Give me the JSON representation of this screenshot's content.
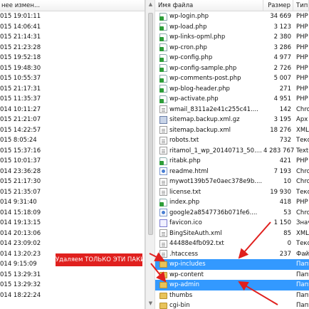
{
  "left_pane": {
    "header": "нее измен...",
    "dates": [
      "015 19:01:11",
      "015 14:06:41",
      "015 21:14:31",
      "015 21:23:28",
      "015 19:52:18",
      "015 19:48:30",
      "015 10:55:37",
      "015 21:17:31",
      "015 11:35:37",
      "014 10:11:27",
      "015 21:21:07",
      "015 14:22:57",
      "015 8:05:24",
      "015 15:37:16",
      "015 10:01:37",
      "014 23:36:28",
      "015 21:17:30",
      "015 21:35:07",
      "014 9:31:40",
      "014 15:18:09",
      "014 19:13:15",
      "014 20:13:06",
      "014 23:09:02",
      "014 13:20:23",
      "014 9:15:09",
      "015 13:29:31",
      "015 13:29:32",
      "014 18:22:24"
    ]
  },
  "right_pane": {
    "columns": {
      "name": "Имя файла",
      "size": "Размер",
      "type": "Тип"
    },
    "files": [
      {
        "name": "wp-login.php",
        "size": "34 669",
        "type": "PHP",
        "icon": "php-file-icon"
      },
      {
        "name": "wp-load.php",
        "size": "3 123",
        "type": "PHP",
        "icon": "php-file-icon"
      },
      {
        "name": "wp-links-opml.php",
        "size": "2 380",
        "type": "PHP",
        "icon": "php-file-icon"
      },
      {
        "name": "wp-cron.php",
        "size": "3 286",
        "type": "PHP",
        "icon": "php-file-icon"
      },
      {
        "name": "wp-config.php",
        "size": "4 977",
        "type": "PHP",
        "icon": "php-file-icon"
      },
      {
        "name": "wp-config-sample.php",
        "size": "2 726",
        "type": "PHP",
        "icon": "php-file-icon"
      },
      {
        "name": "wp-comments-post.php",
        "size": "5 007",
        "type": "PHP",
        "icon": "php-file-icon"
      },
      {
        "name": "wp-blog-header.php",
        "size": "271",
        "type": "PHP",
        "icon": "php-file-icon"
      },
      {
        "name": "wp-activate.php",
        "size": "4 951",
        "type": "PHP",
        "icon": "php-file-icon"
      },
      {
        "name": "wmail_8311a2e41c255c41....",
        "size": "142",
        "type": "Chro",
        "icon": "text-file-icon"
      },
      {
        "name": "sitemap.backup.xml.gz",
        "size": "3 195",
        "type": "Apx",
        "icon": "archive-icon"
      },
      {
        "name": "sitemap.backup.xml",
        "size": "18 276",
        "type": "XML",
        "icon": "text-file-icon"
      },
      {
        "name": "robots.txt",
        "size": "732",
        "type": "Текс",
        "icon": "text-file-icon"
      },
      {
        "name": "ritamol_1_wp_20140713_50....",
        "size": "4 283 767",
        "type": "Text",
        "icon": "text-file-icon"
      },
      {
        "name": "ritabk.php",
        "size": "421",
        "type": "PHP",
        "icon": "php-file-icon"
      },
      {
        "name": "readme.html",
        "size": "7 193",
        "type": "Chro",
        "icon": "web-file-icon"
      },
      {
        "name": "mywot139b57e0aec378e9b....",
        "size": "10",
        "type": "Chro",
        "icon": "text-file-icon"
      },
      {
        "name": "license.txt",
        "size": "19 930",
        "type": "Текс",
        "icon": "text-file-icon"
      },
      {
        "name": "index.php",
        "size": "418",
        "type": "PHP",
        "icon": "php-file-icon"
      },
      {
        "name": "google2a8547736b071fe6....",
        "size": "53",
        "type": "Chro",
        "icon": "web-file-icon"
      },
      {
        "name": "favicon.ico",
        "size": "1 150",
        "type": "Знач",
        "icon": "star-file-icon"
      },
      {
        "name": "BingSiteAuth.xml",
        "size": "85",
        "type": "XML",
        "icon": "text-file-icon"
      },
      {
        "name": "44488e4fb092.txt",
        "size": "0",
        "type": "Текс",
        "icon": "text-file-icon"
      },
      {
        "name": ".htaccess",
        "size": "237",
        "type": "Файл",
        "icon": "text-file-icon"
      },
      {
        "name": "wp-includes",
        "size": "",
        "type": "Папк",
        "icon": "folder-icon",
        "selected": true
      },
      {
        "name": "wp-content",
        "size": "",
        "type": "Папк",
        "icon": "folder-icon"
      },
      {
        "name": "wp-admin",
        "size": "",
        "type": "Папк",
        "icon": "folder-icon",
        "selected": true
      },
      {
        "name": "thumbs",
        "size": "",
        "type": "Папк",
        "icon": "folder-icon"
      },
      {
        "name": "cgi-bin",
        "size": "",
        "type": "Папк",
        "icon": "folder-icon"
      }
    ]
  },
  "annotation": {
    "text": "Удаляем ТОЛЬКО ЭТИ ПАКИ",
    "color": "#e0201e"
  },
  "colors": {
    "selection": "#3399ff",
    "arrow": "#e0201e"
  }
}
